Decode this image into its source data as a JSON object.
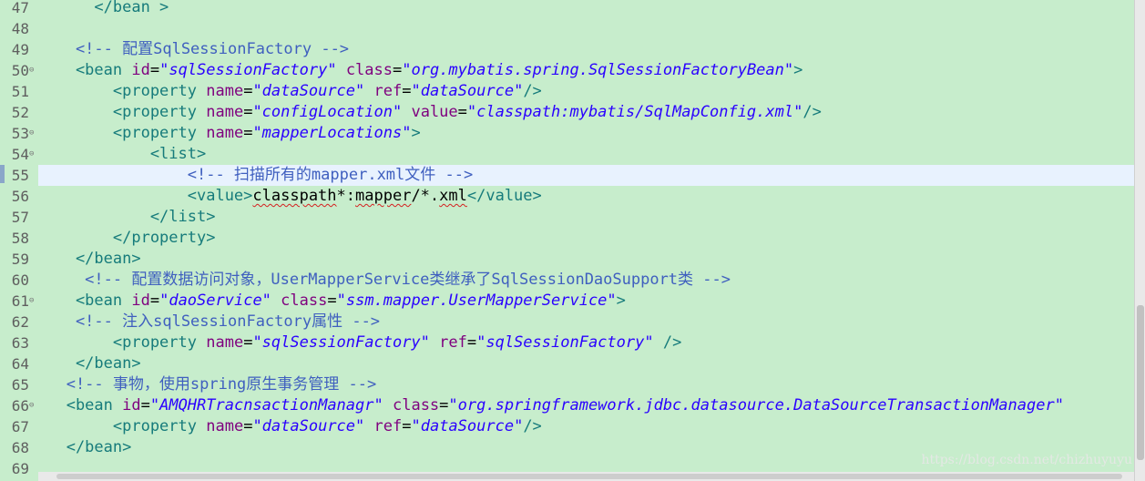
{
  "editor": {
    "highlighted_line": "55",
    "lines": [
      {
        "n": "47",
        "fold": "",
        "tokens": [
          {
            "t": "      </bean >",
            "c": "tag"
          }
        ]
      },
      {
        "n": "48",
        "fold": "",
        "tokens": []
      },
      {
        "n": "49",
        "fold": "",
        "tokens": [
          {
            "t": "    <!-- 配置SqlSessionFactory -->",
            "c": "cmt"
          }
        ]
      },
      {
        "n": "50",
        "fold": "⊖",
        "tokens": [
          {
            "t": "    <bean ",
            "c": "tag"
          },
          {
            "t": "id",
            "c": "attr"
          },
          {
            "t": "=",
            "c": "txt"
          },
          {
            "t": "\"sqlSessionFactory\"",
            "c": "val"
          },
          {
            "t": " ",
            "c": "txt"
          },
          {
            "t": "class",
            "c": "attr"
          },
          {
            "t": "=",
            "c": "txt"
          },
          {
            "t": "\"org.mybatis.spring.SqlSessionFactoryBean\"",
            "c": "val"
          },
          {
            "t": ">",
            "c": "tag"
          }
        ]
      },
      {
        "n": "51",
        "fold": "",
        "tokens": [
          {
            "t": "        <property ",
            "c": "tag"
          },
          {
            "t": "name",
            "c": "attr"
          },
          {
            "t": "=",
            "c": "txt"
          },
          {
            "t": "\"dataSource\"",
            "c": "val"
          },
          {
            "t": " ",
            "c": "txt"
          },
          {
            "t": "ref",
            "c": "attr"
          },
          {
            "t": "=",
            "c": "txt"
          },
          {
            "t": "\"dataSource\"",
            "c": "val"
          },
          {
            "t": "/>",
            "c": "tag"
          }
        ]
      },
      {
        "n": "52",
        "fold": "",
        "tokens": [
          {
            "t": "        <property ",
            "c": "tag"
          },
          {
            "t": "name",
            "c": "attr"
          },
          {
            "t": "=",
            "c": "txt"
          },
          {
            "t": "\"configLocation\"",
            "c": "val"
          },
          {
            "t": " ",
            "c": "txt"
          },
          {
            "t": "value",
            "c": "attr"
          },
          {
            "t": "=",
            "c": "txt"
          },
          {
            "t": "\"classpath:mybatis/SqlMapConfig.xml\"",
            "c": "val"
          },
          {
            "t": "/>",
            "c": "tag"
          }
        ]
      },
      {
        "n": "53",
        "fold": "⊖",
        "tokens": [
          {
            "t": "        <property ",
            "c": "tag"
          },
          {
            "t": "name",
            "c": "attr"
          },
          {
            "t": "=",
            "c": "txt"
          },
          {
            "t": "\"mapperLocations\"",
            "c": "val"
          },
          {
            "t": ">",
            "c": "tag"
          }
        ]
      },
      {
        "n": "54",
        "fold": "⊖",
        "tokens": [
          {
            "t": "            <list>",
            "c": "tag"
          }
        ]
      },
      {
        "n": "55",
        "fold": "",
        "tokens": [
          {
            "t": "                <!-- 扫描所有的mapper.xml文件 -->",
            "c": "cmt"
          }
        ]
      },
      {
        "n": "56",
        "fold": "",
        "tokens": [
          {
            "t": "                <value>",
            "c": "tag"
          },
          {
            "t": "classpath",
            "c": "txt squig"
          },
          {
            "t": "*:",
            "c": "txt"
          },
          {
            "t": "mapper",
            "c": "txt squig"
          },
          {
            "t": "/*.",
            "c": "txt"
          },
          {
            "t": "xml",
            "c": "txt squig"
          },
          {
            "t": "</value>",
            "c": "tag"
          }
        ]
      },
      {
        "n": "57",
        "fold": "",
        "tokens": [
          {
            "t": "            </list>",
            "c": "tag"
          }
        ]
      },
      {
        "n": "58",
        "fold": "",
        "tokens": [
          {
            "t": "        </property>",
            "c": "tag"
          }
        ]
      },
      {
        "n": "59",
        "fold": "",
        "tokens": [
          {
            "t": "    </bean>",
            "c": "tag"
          }
        ]
      },
      {
        "n": "60",
        "fold": "",
        "tokens": [
          {
            "t": "     <!-- 配置数据访问对象，UserMapperService类继承了SqlSessionDaoSupport类 -->",
            "c": "cmt"
          }
        ]
      },
      {
        "n": "61",
        "fold": "⊖",
        "tokens": [
          {
            "t": "    <bean ",
            "c": "tag"
          },
          {
            "t": "id",
            "c": "attr"
          },
          {
            "t": "=",
            "c": "txt"
          },
          {
            "t": "\"daoService\"",
            "c": "val"
          },
          {
            "t": " ",
            "c": "txt"
          },
          {
            "t": "class",
            "c": "attr"
          },
          {
            "t": "=",
            "c": "txt"
          },
          {
            "t": "\"ssm.mapper.UserMapperService\"",
            "c": "val"
          },
          {
            "t": ">",
            "c": "tag"
          }
        ]
      },
      {
        "n": "62",
        "fold": "",
        "tokens": [
          {
            "t": "    <!-- 注入sqlSessionFactory属性 -->",
            "c": "cmt"
          }
        ]
      },
      {
        "n": "63",
        "fold": "",
        "tokens": [
          {
            "t": "        <property ",
            "c": "tag"
          },
          {
            "t": "name",
            "c": "attr"
          },
          {
            "t": "=",
            "c": "txt"
          },
          {
            "t": "\"sqlSessionFactory\"",
            "c": "val"
          },
          {
            "t": " ",
            "c": "txt"
          },
          {
            "t": "ref",
            "c": "attr"
          },
          {
            "t": "=",
            "c": "txt"
          },
          {
            "t": "\"sqlSessionFactory\"",
            "c": "val"
          },
          {
            "t": " />",
            "c": "tag"
          }
        ]
      },
      {
        "n": "64",
        "fold": "",
        "tokens": [
          {
            "t": "    </bean>",
            "c": "tag"
          }
        ]
      },
      {
        "n": "65",
        "fold": "",
        "tokens": [
          {
            "t": "   <!-- 事物，使用spring原生事务管理 -->",
            "c": "cmt"
          }
        ]
      },
      {
        "n": "66",
        "fold": "⊖",
        "tokens": [
          {
            "t": "   <bean ",
            "c": "tag"
          },
          {
            "t": "id",
            "c": "attr"
          },
          {
            "t": "=",
            "c": "txt"
          },
          {
            "t": "\"AMQHRTracnsactionManagr\"",
            "c": "val"
          },
          {
            "t": " ",
            "c": "txt"
          },
          {
            "t": "class",
            "c": "attr"
          },
          {
            "t": "=",
            "c": "txt"
          },
          {
            "t": "\"org.springframework.jdbc.datasource.DataSourceTransactionManager\"",
            "c": "val"
          }
        ]
      },
      {
        "n": "67",
        "fold": "",
        "tokens": [
          {
            "t": "        <property ",
            "c": "tag"
          },
          {
            "t": "name",
            "c": "attr"
          },
          {
            "t": "=",
            "c": "txt"
          },
          {
            "t": "\"dataSource\"",
            "c": "val"
          },
          {
            "t": " ",
            "c": "txt"
          },
          {
            "t": "ref",
            "c": "attr"
          },
          {
            "t": "=",
            "c": "txt"
          },
          {
            "t": "\"dataSource\"",
            "c": "val"
          },
          {
            "t": "/>",
            "c": "tag"
          }
        ]
      },
      {
        "n": "68",
        "fold": "",
        "tokens": [
          {
            "t": "   </bean>",
            "c": "tag"
          }
        ]
      },
      {
        "n": "69",
        "fold": "",
        "tokens": []
      }
    ]
  },
  "watermark": "https://blog.csdn.net/chizhuyuyu",
  "colors": {
    "background": "#c7edcc",
    "tag": "#167b7b",
    "attribute": "#7f007f",
    "value": "#2a00ff",
    "comment": "#3f5fbf",
    "current_line": "#e8f2fe"
  }
}
